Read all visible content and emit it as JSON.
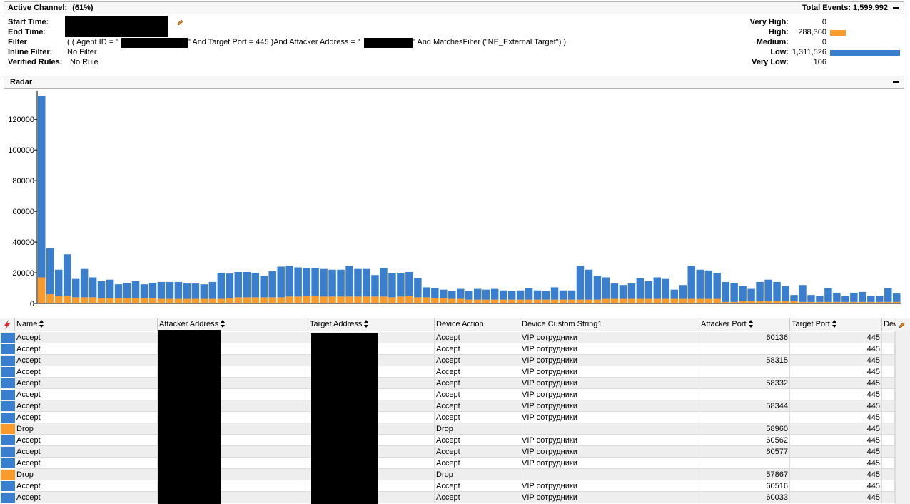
{
  "header": {
    "title": "Active Channel:",
    "percent": "(61%)",
    "total_events": "Total Events: 1,599,992"
  },
  "info": {
    "start_time_label": "Start Time:",
    "end_time_label": "End Time:",
    "filter_label": "Filter",
    "filter_text_1": "( ( Agent ID = \"",
    "filter_text_2": "\" And Target Port = 445  )And Attacker Address = \"",
    "filter_text_3": "\" And MatchesFilter (\"NE_External Target\")  )",
    "inline_filter_label": "Inline Filter:",
    "inline_filter_value": "No Filter",
    "verified_rules_label": "Verified Rules:",
    "verified_rules_value": "No Rule"
  },
  "severity": [
    {
      "label": "Very High:",
      "value": "0",
      "fraction": 0,
      "color": ""
    },
    {
      "label": "High:",
      "value": "288,360",
      "fraction": 0.18,
      "color": "#f99a2c"
    },
    {
      "label": "Medium:",
      "value": "0",
      "fraction": 0,
      "color": ""
    },
    {
      "label": "Low:",
      "value": "1,311,526",
      "fraction": 0.82,
      "color": "#3a7fce"
    },
    {
      "label": "Very Low:",
      "value": "106",
      "fraction": 0,
      "color": ""
    }
  ],
  "radar": {
    "title": "Radar"
  },
  "chart_data": {
    "type": "bar",
    "stacked": true,
    "yticks": [
      "0",
      "20000",
      "40000",
      "60000",
      "80000",
      "100000",
      "120000"
    ],
    "ylim": [
      0,
      135000
    ],
    "grid": false,
    "series": [
      {
        "color": "#f99a2c",
        "values": [
          17000,
          6000,
          5000,
          5000,
          4000,
          4000,
          4000,
          3500,
          3500,
          3500,
          3500,
          3500,
          3500,
          3500,
          3000,
          3000,
          3000,
          3000,
          3000,
          3000,
          3000,
          3000,
          3500,
          4000,
          4000,
          4000,
          4000,
          4000,
          4000,
          4500,
          4500,
          5000,
          5000,
          4500,
          4500,
          4500,
          4500,
          4500,
          4500,
          4500,
          4500,
          4000,
          4500,
          5000,
          4000,
          4000,
          3500,
          3500,
          3000,
          3000,
          2500,
          2500,
          2500,
          2500,
          2500,
          2500,
          2500,
          2500,
          2500,
          2500,
          2500,
          2500,
          2500,
          2500,
          2500,
          2500,
          3000,
          3000,
          3000,
          3000,
          3000,
          3000,
          3000,
          3000,
          3000,
          3000,
          3000,
          3000,
          3000,
          3000,
          1000,
          1000,
          1500,
          1500,
          1500,
          1500,
          1500,
          1500,
          1500,
          1000,
          1000,
          1000,
          1000,
          1000,
          1000,
          1000,
          1000,
          1000,
          1000,
          1000,
          1000,
          1000,
          1000,
          1000,
          1000,
          1000,
          1000,
          1000,
          1000,
          1000,
          1000,
          1000,
          1000
        ]
      },
      {
        "color": "#3a7fce",
        "values": [
          118000,
          30000,
          17000,
          27000,
          12000,
          18500,
          13000,
          11000,
          12000,
          9000,
          10000,
          11000,
          9000,
          10000,
          11000,
          11000,
          11000,
          10000,
          10000,
          9500,
          11000,
          17000,
          16000,
          16500,
          16500,
          16000,
          14000,
          17000,
          20000,
          20000,
          19000,
          18000,
          18000,
          18000,
          17500,
          17500,
          20000,
          18000,
          18000,
          14000,
          18500,
          16000,
          15500,
          15500,
          12500,
          6500,
          6500,
          5500,
          5000,
          6500,
          5500,
          7000,
          6500,
          7000,
          6000,
          5500,
          6000,
          7500,
          6000,
          5500,
          8000,
          6000,
          6000,
          22000,
          19500,
          15500,
          14000,
          10000,
          9000,
          10000,
          13500,
          11500,
          14000,
          13000,
          6000,
          9000,
          21500,
          19000,
          18500,
          17000,
          13000,
          12500,
          10000,
          8000,
          12500,
          14000,
          12500,
          10000,
          4000,
          11000,
          4500,
          4000,
          9000,
          6000,
          4000,
          6000,
          6500,
          4000,
          4000,
          9000,
          5500
        ]
      }
    ]
  },
  "table": {
    "columns": [
      "",
      "Name",
      "Attacker Address",
      "Target Address",
      "Device Action",
      "Device Custom String1",
      "Attacker Port",
      "Target Port",
      "Dev"
    ],
    "rows": [
      {
        "sev": "#3a7fce",
        "name": "Accept",
        "action": "Accept",
        "dcs1": "VIP сотрудники",
        "aport": "60136",
        "tport": "445"
      },
      {
        "sev": "#3a7fce",
        "name": "Accept",
        "action": "Accept",
        "dcs1": "VIP сотрудники",
        "aport": "",
        "tport": "445"
      },
      {
        "sev": "#3a7fce",
        "name": "Accept",
        "action": "Accept",
        "dcs1": "VIP сотрудники",
        "aport": "58315",
        "tport": "445"
      },
      {
        "sev": "#3a7fce",
        "name": "Accept",
        "action": "Accept",
        "dcs1": "VIP сотрудники",
        "aport": "",
        "tport": "445"
      },
      {
        "sev": "#3a7fce",
        "name": "Accept",
        "action": "Accept",
        "dcs1": "VIP сотрудники",
        "aport": "58332",
        "tport": "445"
      },
      {
        "sev": "#3a7fce",
        "name": "Accept",
        "action": "Accept",
        "dcs1": "VIP сотрудники",
        "aport": "",
        "tport": "445"
      },
      {
        "sev": "#3a7fce",
        "name": "Accept",
        "action": "Accept",
        "dcs1": "VIP сотрудники",
        "aport": "58344",
        "tport": "445"
      },
      {
        "sev": "#3a7fce",
        "name": "Accept",
        "action": "Accept",
        "dcs1": "VIP сотрудники",
        "aport": "",
        "tport": "445"
      },
      {
        "sev": "#f99a2c",
        "name": "Drop",
        "action": "Drop",
        "dcs1": "",
        "aport": "58960",
        "tport": "445"
      },
      {
        "sev": "#3a7fce",
        "name": "Accept",
        "action": "Accept",
        "dcs1": "VIP сотрудники",
        "aport": "60562",
        "tport": "445"
      },
      {
        "sev": "#3a7fce",
        "name": "Accept",
        "action": "Accept",
        "dcs1": "VIP сотрудники",
        "aport": "60577",
        "tport": "445"
      },
      {
        "sev": "#3a7fce",
        "name": "Accept",
        "action": "Accept",
        "dcs1": "VIP сотрудники",
        "aport": "",
        "tport": "445"
      },
      {
        "sev": "#f99a2c",
        "name": "Drop",
        "action": "Drop",
        "dcs1": "",
        "aport": "57867",
        "tport": "445"
      },
      {
        "sev": "#3a7fce",
        "name": "Accept",
        "action": "Accept",
        "dcs1": "VIP сотрудники",
        "aport": "60516",
        "tport": "445"
      },
      {
        "sev": "#3a7fce",
        "name": "Accept",
        "action": "Accept",
        "dcs1": "VIP сотрудники",
        "aport": "60033",
        "tport": "445"
      }
    ]
  }
}
